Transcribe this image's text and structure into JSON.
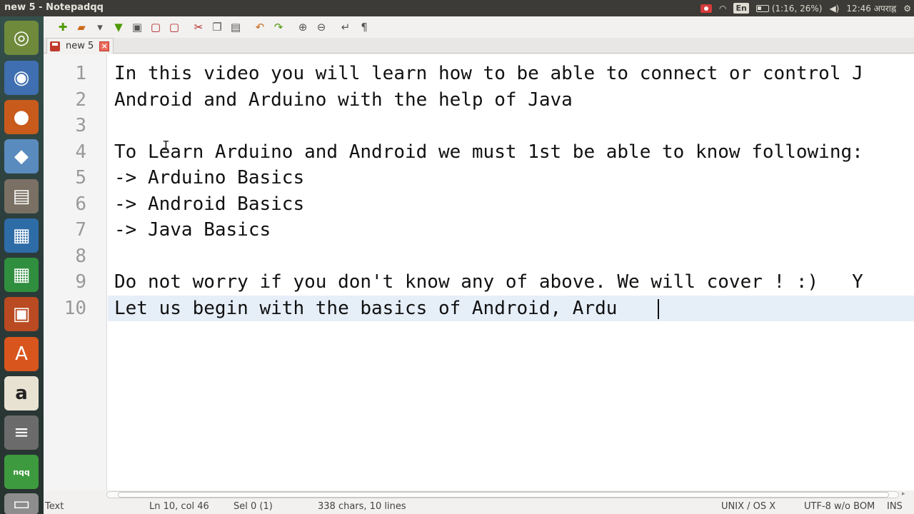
{
  "window": {
    "title": "new 5 - Notepadqq"
  },
  "panel": {
    "lang": "En",
    "battery": "(1:16, 26%)",
    "clock": "12:46 अपराह्न"
  },
  "launcher": {
    "nqq_label": "nqq"
  },
  "tab": {
    "label": "new 5",
    "close_glyph": "×"
  },
  "editor": {
    "line_numbers": [
      "1",
      "2",
      "3",
      "4",
      "5",
      "6",
      "7",
      "8",
      "9",
      "10"
    ],
    "lines": [
      "In this video you will learn how to be able to connect or control J",
      "Android and Arduino with the help of Java",
      "",
      "To Learn Arduino and Android we must 1st be able to know following:",
      "-> Arduino Basics",
      "-> Android Basics",
      "-> Java Basics",
      "",
      "Do not worry if you don't know any of above. We will cover ! :)   Y",
      "Let us begin with the basics of Android, Ardu"
    ],
    "current_line": 10
  },
  "status": {
    "mode": "Text",
    "position": "Ln 10, col 46",
    "selection": "Sel 0 (1)",
    "counts": "338 chars, 10 lines",
    "eol": "UNIX / OS X",
    "encoding": "UTF-8 w/o BOM",
    "insert_mode": "INS"
  }
}
